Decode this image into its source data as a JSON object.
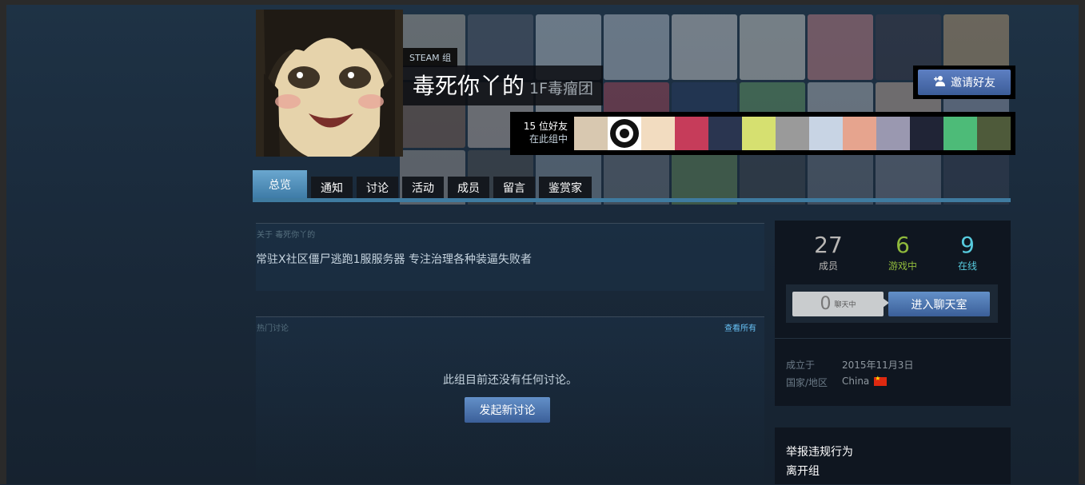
{
  "header": {
    "group_tag": "STEAM 组",
    "group_name": "毒死你丫的",
    "group_abbr": "1F毒瘤团",
    "invite_label": "邀请好友",
    "friends_count": "15 位好友",
    "friends_sub": "在此组中"
  },
  "tabs": [
    "总览",
    "通知",
    "讨论",
    "活动",
    "成员",
    "留言",
    "鉴赏家"
  ],
  "about": {
    "label": "关于 毒死你丫的",
    "text": "常驻X社区僵尸逃跑1服服务器 专注治理各种装逼失败者"
  },
  "discussions": {
    "label": "热门讨论",
    "view_all": "查看所有",
    "empty_text": "此组目前还没有任何讨论。",
    "start_button": "发起新讨论"
  },
  "stats": {
    "members": {
      "value": "27",
      "label": "成员",
      "color": "#b8b6b4"
    },
    "ingame": {
      "value": "6",
      "label": "游戏中",
      "color": "#90ba3c"
    },
    "online": {
      "value": "9",
      "label": "在线",
      "color": "#57cbde"
    }
  },
  "chat": {
    "count": "0",
    "count_label": "聊天中",
    "enter_label": "进入聊天室"
  },
  "info": {
    "founded_label": "成立于",
    "founded_value": "2015年11月3日",
    "country_label": "国家/地区",
    "country_value": "China"
  },
  "actions": {
    "report": "举报违规行为",
    "leave": "离开组"
  },
  "icons": {
    "invite": "add-friend-icon",
    "flag": "china-flag-icon"
  }
}
